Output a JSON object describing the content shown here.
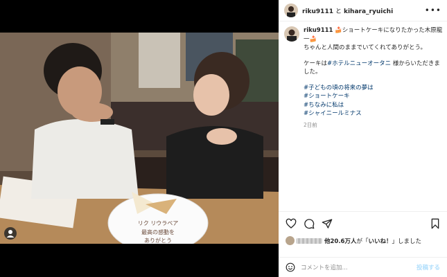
{
  "header": {
    "user1": "riku9111",
    "joiner": "と",
    "user2": "kihara_ryuichi",
    "more": "•••"
  },
  "caption": {
    "user": "riku9111",
    "line1_emoji": "🍰",
    "line1_text": "ショートケーキになりたかった木原龍一",
    "line1_end_emoji": "🍰",
    "line2": "ちゃんと人間のままでいてくれてありがとう。",
    "line3_prefix": "ケーキは",
    "line3_tag": "#ホテルニューオータニ",
    "line3_suffix": " 様からいただきました。",
    "hashtags": [
      "#子どもの頃の将来の夢は",
      "#ショートケーキ",
      "#ちなみに私は",
      "#シャイニールミナス"
    ],
    "time": "2日前"
  },
  "likes": {
    "count_text": "他20.6万人",
    "middle": "が「",
    "quote": "いいね！",
    "end": "」しました"
  },
  "comment": {
    "placeholder": "コメントを追加...",
    "post": "投稿する"
  },
  "plate": {
    "line1": "リク リウラペア",
    "line2": "最高の感動を",
    "line3": "ありがとう"
  }
}
